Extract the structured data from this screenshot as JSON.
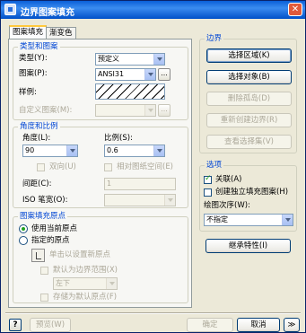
{
  "window": {
    "title": "边界图案填充",
    "close_glyph": "✕"
  },
  "tabs": [
    {
      "label": "图案填充",
      "active": true
    },
    {
      "label": "渐变色",
      "active": false
    }
  ],
  "type_pattern": {
    "legend": "类型和图案",
    "type_label": "类型(Y):",
    "type_value": "预定义",
    "pattern_label": "图案(P):",
    "pattern_value": "ANSI31",
    "browse_glyph": "...",
    "sample_label": "样例:",
    "custom_label": "自定义图案(M):",
    "custom_value": ""
  },
  "angle_scale": {
    "legend": "角度和比例",
    "angle_label": "角度(L):",
    "angle_value": "90",
    "scale_label": "比例(S):",
    "scale_value": "0.6",
    "double_label": "双向(U)",
    "relative_label": "相对图纸空间(E)",
    "spacing_label": "间距(C):",
    "spacing_value": "1",
    "iso_label": "ISO 笔宽(O):",
    "iso_value": ""
  },
  "origin": {
    "legend": "图案填充原点",
    "use_current_label": "使用当前原点",
    "specified_label": "指定的原点",
    "click_set_label": "单击以设置新原点",
    "default_extents_label": "默认为边界范围(X)",
    "extents_value": "左下",
    "store_default_label": "存储为默认原点(F)"
  },
  "boundary": {
    "legend": "边界",
    "pick_points": "选择区域(K)",
    "select_objects": "选择对象(B)",
    "remove_islands": "删除孤岛(D)",
    "recreate_boundary": "重新创建边界(R)",
    "view_selections": "查看选择集(V)"
  },
  "options": {
    "legend": "选项",
    "associative_label": "关联(A)",
    "associative_checked": true,
    "independent_label": "创建独立填充图案(H)",
    "draw_order_label": "绘图次序(W):",
    "draw_order_value": "不指定"
  },
  "inherit_button": "继承特性(I)",
  "footer": {
    "help_glyph": "?",
    "preview": "预览(W)",
    "ok": "确定",
    "cancel": "取消",
    "more_glyph": "≫"
  }
}
